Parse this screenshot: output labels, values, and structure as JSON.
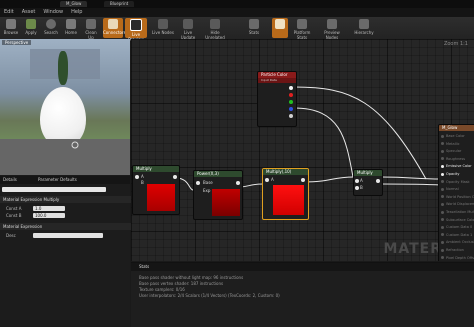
{
  "window": {
    "title": "M_Glow",
    "tabs": [
      "M_Glow",
      "Blueprint"
    ]
  },
  "menu": [
    "Edit",
    "Asset",
    "Window",
    "Help"
  ],
  "toolbar": {
    "left": [
      "Browse",
      "Apply",
      "Search",
      "Home",
      "Clean Up",
      "Connectors",
      "Live Preview"
    ],
    "right": [
      "Live Nodes",
      "Live Update",
      "Hide Unrelated",
      "Stats",
      "Release Stats",
      "Platform Stats",
      "Preview Nodes",
      "Hierarchy"
    ],
    "active": [
      "Connectors",
      "Live Preview",
      "Stats"
    ]
  },
  "viewport": {
    "label": "Perspective"
  },
  "details": {
    "tabs": [
      "Details",
      "Parameter Defaults"
    ],
    "search_placeholder": "Search Details",
    "sections": [
      "Material Expression Multiply",
      "Material Expression"
    ],
    "field_const_a": "Const A",
    "field_const_b": "Const B",
    "const_a_value": "1.0",
    "const_b_value": "100.0",
    "desc_label": "Desc"
  },
  "graph": {
    "zoom": "Zoom 1:1",
    "watermark": "MATERIAL",
    "nodes": {
      "particle_color": {
        "title": "Particle Color",
        "subtitle": "Input Data"
      },
      "multiply1": {
        "title": "Multiply",
        "pins": [
          "A",
          "B"
        ]
      },
      "power": {
        "title": "Power(X,3)",
        "pins": [
          "Base",
          "Exp"
        ]
      },
      "multiply2": {
        "title": "Multiply(,10)",
        "pins": [
          "A",
          "B"
        ]
      },
      "multiply3": {
        "title": "Multiply",
        "pins": [
          "A",
          "B"
        ]
      },
      "result": {
        "title": "M_Glow",
        "pins": [
          "Base Color",
          "Metallic",
          "Specular",
          "Roughness",
          "Emissive Color",
          "Opacity",
          "Opacity Mask",
          "Normal",
          "World Position Offset",
          "World Displacement",
          "Tessellation Multiplier",
          "Subsurface Color",
          "Custom Data 0",
          "Custom Data 1",
          "Ambient Occlusion",
          "Refraction",
          "Pixel Depth Offset"
        ]
      }
    }
  },
  "stats": {
    "title": "Stats",
    "lines": [
      "Base pass shader without light map: 96 instructions",
      "Base pass vertex shader: 187 instructions",
      "Texture samplers: 0/16",
      "User interpolators: 2/4 Scalars (1/4 Vectors) (TexCoords: 2, Custom: 0)"
    ]
  },
  "colors": {
    "accent": "#b86a1a",
    "preview_red": "#e00000",
    "node_header_green": "#2e4a2e",
    "node_header_red": "#8a1a1a"
  }
}
